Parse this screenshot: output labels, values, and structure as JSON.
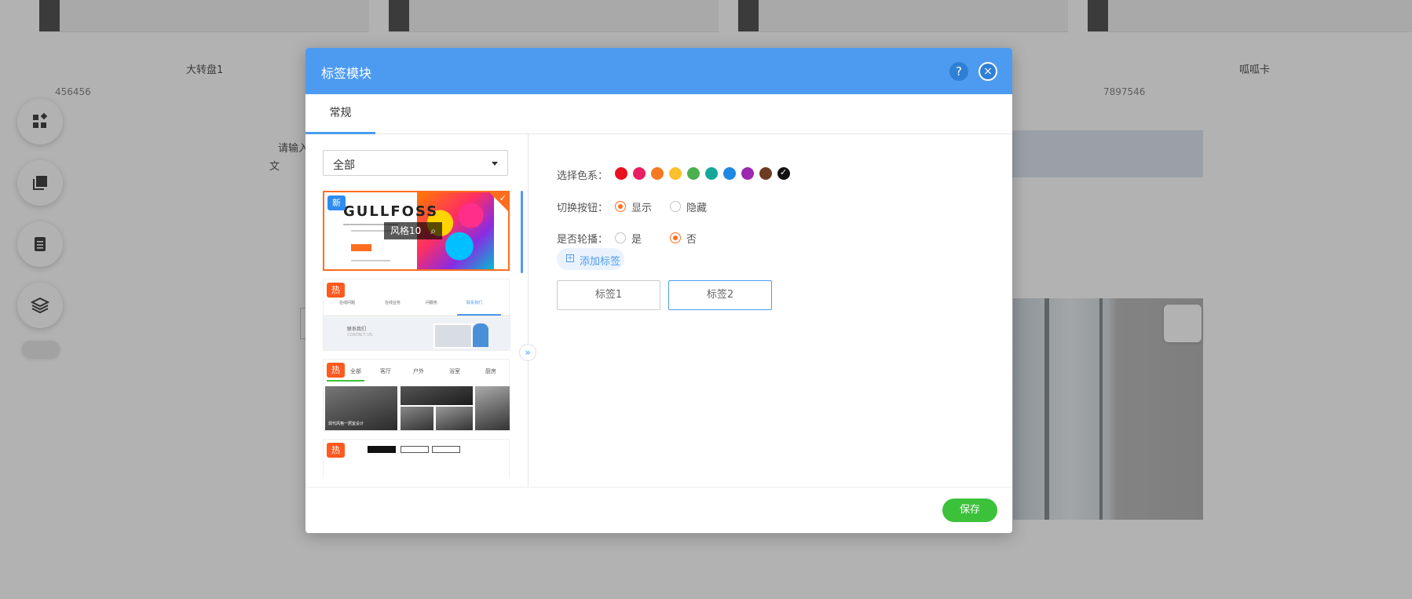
{
  "background": {
    "thumb_captions": [
      "大转盘1",
      "呱呱卡"
    ],
    "thumb_numbers": [
      "456456",
      "7897546"
    ],
    "placeholder_text_1": "请输入",
    "placeholder_text_2": "文",
    "side_icons": [
      "apps-icon",
      "copy-icon",
      "page-icon",
      "layers-icon"
    ]
  },
  "modal": {
    "title": "标签模块",
    "help_label": "?",
    "close_label": "×",
    "tabs": [
      {
        "label": "常规"
      }
    ],
    "category_select": {
      "value": "全部"
    },
    "styles": [
      {
        "badge": "新",
        "selected": true,
        "logo": "GULLFOSS",
        "preview_label": "风格10"
      },
      {
        "badge": "热",
        "nav": [
          "在线问题",
          "在线业务",
          "问服务",
          "联系我们"
        ],
        "heading": "联系我们",
        "subheading": "CONTACT US"
      },
      {
        "badge": "热",
        "nav": [
          "全部",
          "客厅",
          "户外",
          "浴室",
          "厨房"
        ],
        "caption": "现代风格一居室设计"
      },
      {
        "badge": "热"
      }
    ],
    "collapse_icon": "»",
    "settings": {
      "color_label": "选择色系：",
      "colors": [
        "#e8101e",
        "#e91e63",
        "#f47920",
        "#fbc02d",
        "#4caf50",
        "#14a89a",
        "#1e88e5",
        "#9c27b0",
        "#6d3b24",
        "#111111"
      ],
      "active_color_index": 9,
      "switch_label": "切换按钮：",
      "switch_options": [
        "显示",
        "隐藏"
      ],
      "switch_selected": 0,
      "carousel_label": "是否轮播：",
      "carousel_options": [
        "是",
        "否"
      ],
      "carousel_selected": 1,
      "add_tag_label": "添加标签",
      "tags": [
        "标签1",
        "标签2"
      ],
      "active_tag_index": 1
    },
    "save_label": "保存"
  },
  "colors": {
    "header": "#4d9bf0",
    "accent_orange": "#ff6d1f",
    "save_green": "#3cc13a"
  }
}
